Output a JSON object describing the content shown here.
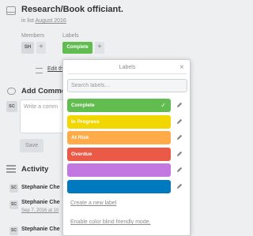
{
  "card": {
    "title": "Research/Book officiant.",
    "in_list_prefix": "in list",
    "list_name": "August 2016"
  },
  "members": {
    "heading": "Members",
    "avatar_initials": "SH",
    "add_symbol": "+"
  },
  "labels_section": {
    "heading": "Labels",
    "applied_label": "Complete",
    "add_symbol": "+"
  },
  "description": {
    "edit_link": "Edit the de"
  },
  "comment": {
    "heading": "Add Comme",
    "avatar_initials": "SC",
    "placeholder": "Write a comm",
    "save_label": "Save"
  },
  "activity": {
    "heading": "Activity",
    "items": [
      {
        "initials": "SC",
        "name": "Stephanie Che",
        "time_prefix": "",
        "time_link": ""
      },
      {
        "initials": "SC",
        "name": "Stephanie Che",
        "time_prefix": "Sep 7, 2016 at 10",
        "time_link": ""
      },
      {
        "initials": "SC",
        "name": "Stephanie Che",
        "time_prefix": "",
        "time_link": ""
      }
    ]
  },
  "labels_popover": {
    "title": "Labels",
    "close_symbol": "×",
    "search_placeholder": "Search labels…",
    "labels": [
      {
        "name": "Complete",
        "color": "#61bd4f",
        "selected": true
      },
      {
        "name": "In Progress",
        "color": "#f2d600",
        "selected": false
      },
      {
        "name": "At Risk",
        "color": "#ffab4a",
        "selected": false
      },
      {
        "name": "Overdue",
        "color": "#eb5a46",
        "selected": false
      },
      {
        "name": "",
        "color": "#c377e0",
        "selected": false
      },
      {
        "name": "",
        "color": "#0079bf",
        "selected": false
      }
    ],
    "check_symbol": "✓",
    "create_link": "Create a new label",
    "colorblind_link": "Enable color blind friendly mode."
  }
}
